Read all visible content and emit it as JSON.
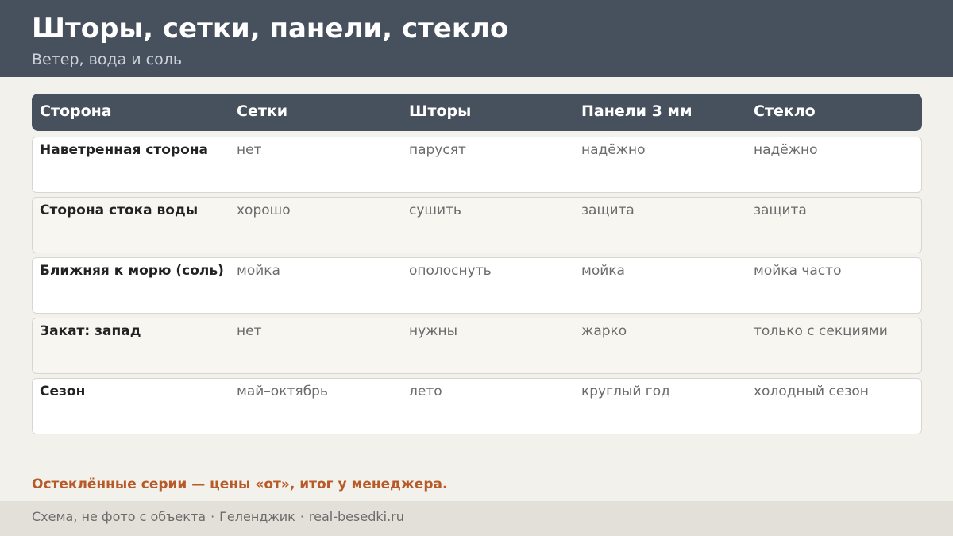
{
  "header": {
    "title": "Шторы, сетки, панели, стекло",
    "subtitle": "Ветер, вода и соль"
  },
  "table": {
    "columns": [
      "Сторона",
      "Сетки",
      "Шторы",
      "Панели 3 мм",
      "Стекло"
    ],
    "rows": [
      [
        "Наветренная сторона",
        "нет",
        "парусят",
        "надёжно",
        "надёжно"
      ],
      [
        "Сторона стока воды",
        "хорошо",
        "сушить",
        "защита",
        "защита"
      ],
      [
        "Ближняя к морю (соль)",
        "мойка",
        "ополоснуть",
        "мойка",
        "мойка часто"
      ],
      [
        "Закат: запад",
        "нет",
        "нужны",
        "жарко",
        "только с секциями"
      ],
      [
        "Сезон",
        "май–октябрь",
        "лето",
        "круглый год",
        "холодный сезон"
      ]
    ]
  },
  "note": "Остеклённые серии — цены «от», итог у менеджера.",
  "footer": {
    "items": [
      "Схема, не фото с объекта",
      "Геленджик",
      "real-besedki.ru"
    ],
    "separator": "·"
  },
  "colors": {
    "header_bg": "#47505d",
    "accent": "#b85a28",
    "page_bg": "#f3f1ec"
  }
}
